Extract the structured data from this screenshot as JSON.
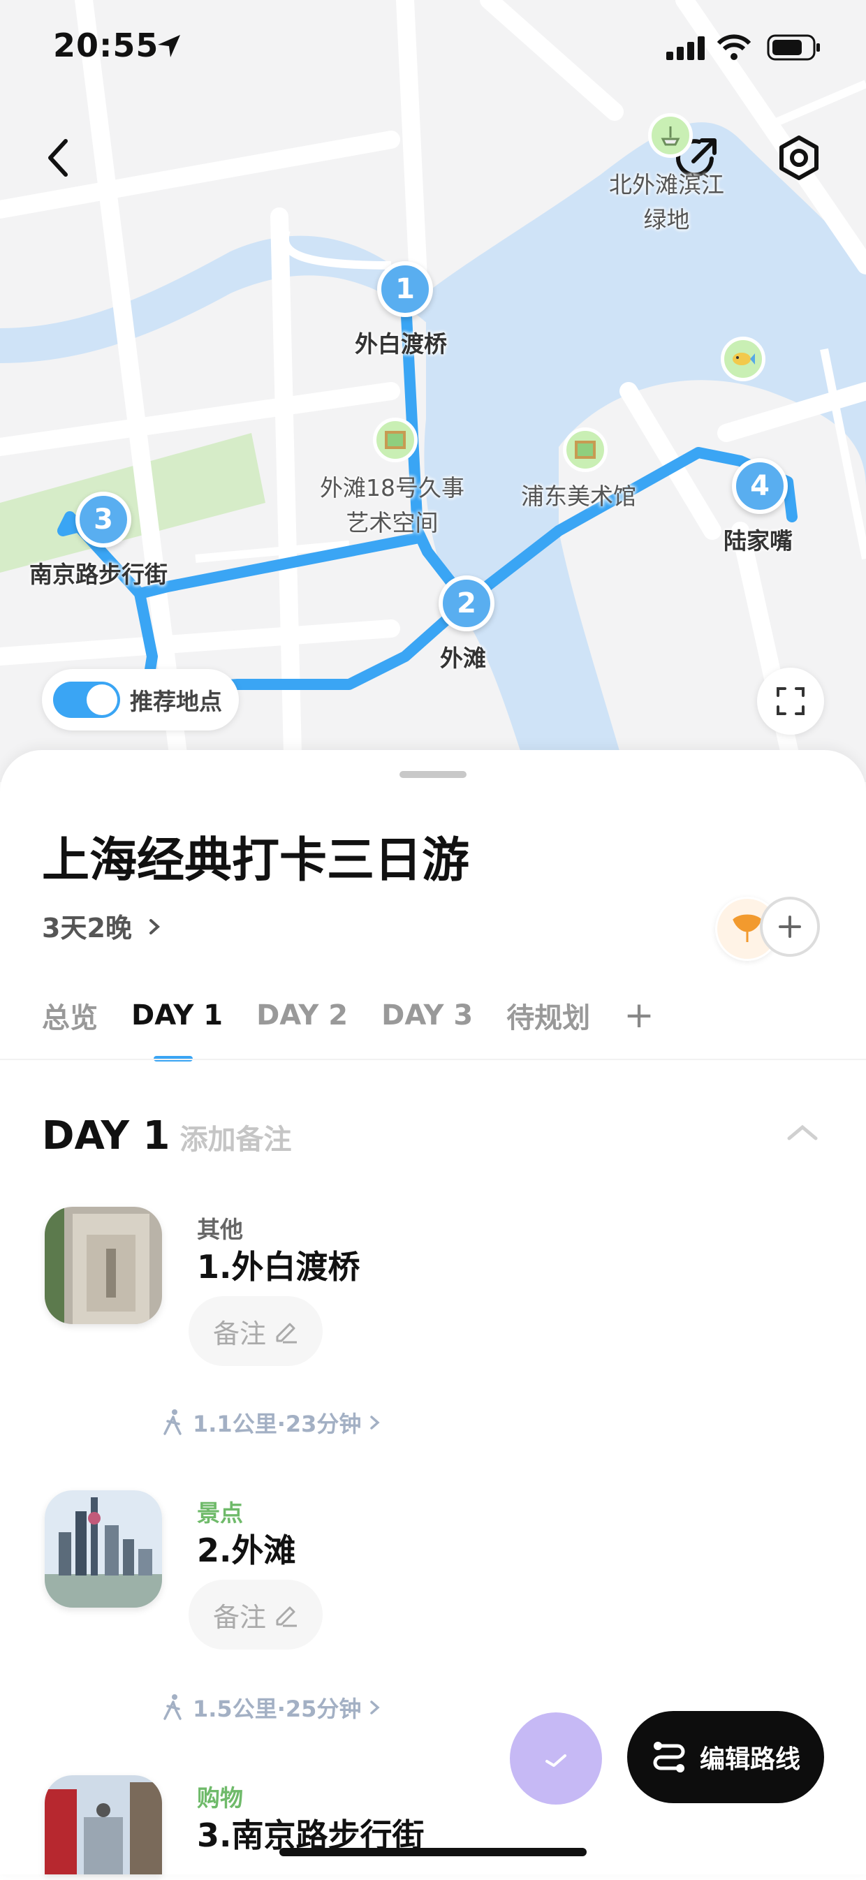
{
  "status_bar": {
    "time": "20:55"
  },
  "map": {
    "stops": [
      {
        "num": "1",
        "label": "外白渡桥"
      },
      {
        "num": "2",
        "label": "外滩"
      },
      {
        "num": "3",
        "label": "南京路步行街"
      },
      {
        "num": "4",
        "label": "陆家嘴"
      }
    ],
    "pois": {
      "art_space_line1": "外滩18号久事",
      "art_space_line2": "艺术空间",
      "pudong_museum": "浦东美术馆",
      "north_bund_line1": "北外滩滨江",
      "north_bund_line2": "绿地"
    },
    "toggle_label": "推荐地点",
    "route_color": "#3aa5f4",
    "water_color": "#cfe3f7",
    "park_color": "#d6ecc8"
  },
  "trip": {
    "title": "上海经典打卡三日游",
    "duration": "3天2晚"
  },
  "tabs": [
    {
      "label": "总览"
    },
    {
      "label": "DAY 1"
    },
    {
      "label": "DAY 2"
    },
    {
      "label": "DAY 3"
    },
    {
      "label": "待规划"
    },
    {
      "label": "+"
    }
  ],
  "day": {
    "title": "DAY 1",
    "note_placeholder": "添加备注"
  },
  "stops": [
    {
      "category": "其他",
      "name": "1.外白渡桥",
      "note": "备注"
    },
    {
      "category": "景点",
      "name": "2.外滩",
      "note": "备注"
    },
    {
      "category": "购物",
      "name": "3.南京路步行街"
    }
  ],
  "walks": [
    {
      "text": "1.1公里·23分钟"
    },
    {
      "text": "1.5公里·25分钟"
    }
  ],
  "actions": {
    "edit_route": "编辑路线"
  }
}
